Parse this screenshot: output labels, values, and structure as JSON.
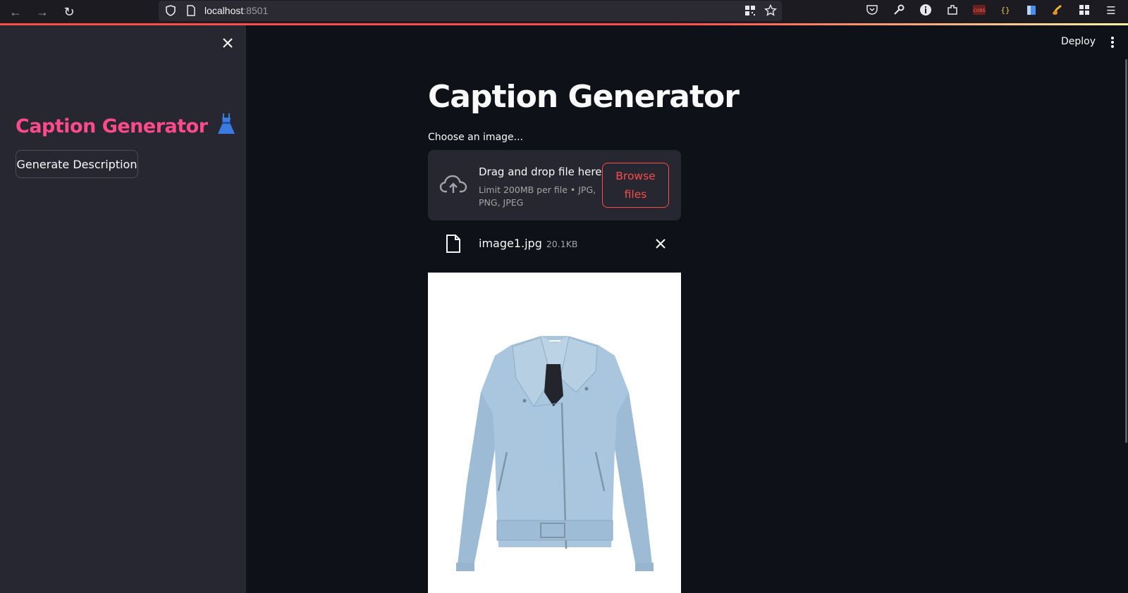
{
  "browser": {
    "url_host": "localhost",
    "url_port": ":8501"
  },
  "sidebar": {
    "title": "Caption Generator",
    "title_icon": "dress-icon",
    "generate_button_label": "Generate Description"
  },
  "header": {
    "deploy_label": "Deploy"
  },
  "main": {
    "title": "Caption Generator",
    "uploader": {
      "label": "Choose an image...",
      "drop_title": "Drag and drop file here",
      "limit_text": "Limit 200MB per file • JPG, PNG, JPEG",
      "browse_line1": "Browse",
      "browse_line2": "files"
    },
    "uploaded_file": {
      "name": "image1.jpg",
      "size": "20.1KB"
    },
    "preview_image": "light-blue-biker-jacket"
  },
  "colors": {
    "accent": "#ff4b4b",
    "sidebar_title": "#ff4b8b",
    "background": "#0e1117",
    "sidebar_bg": "#262730"
  }
}
